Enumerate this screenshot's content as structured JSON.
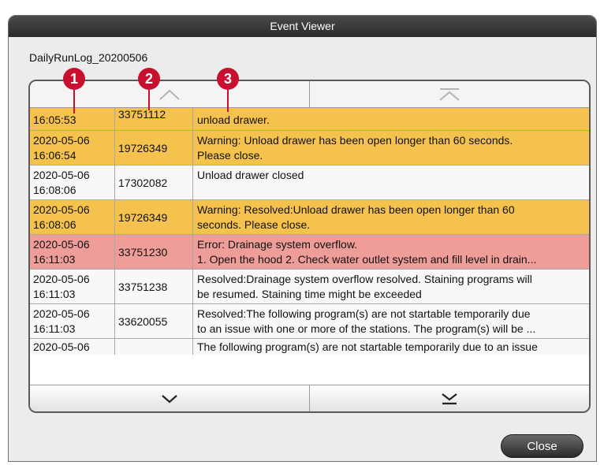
{
  "window": {
    "title": "Event Viewer"
  },
  "log_name": "DailyRunLog_20200506",
  "markers": [
    "1",
    "2",
    "3"
  ],
  "rows": [
    {
      "type": "warn",
      "date": "",
      "time": "16:05:53",
      "event_id": "33751112",
      "message_lines": [
        "unload drawer."
      ]
    },
    {
      "type": "warn",
      "date": "2020-05-06",
      "time": "16:06:54",
      "event_id": "19726349",
      "message_lines": [
        "Warning: Unload drawer has been open longer than 60 seconds.",
        "Please close."
      ]
    },
    {
      "type": "info",
      "date": "2020-05-06",
      "time": "16:08:06",
      "event_id": "17302082",
      "message_lines": [
        "Unload drawer closed"
      ]
    },
    {
      "type": "warn",
      "date": "2020-05-06",
      "time": "16:08:06",
      "event_id": "19726349",
      "message_lines": [
        "Warning: Resolved:Unload drawer has been open longer than 60",
        "seconds. Please close."
      ]
    },
    {
      "type": "error",
      "date": "2020-05-06",
      "time": "16:11:03",
      "event_id": "33751230",
      "message_lines": [
        "Error: Drainage system overflow.",
        "1. Open the hood 2. Check water outlet system and fill level in drain..."
      ]
    },
    {
      "type": "info",
      "date": "2020-05-06",
      "time": "16:11:03",
      "event_id": "33751238",
      "message_lines": [
        "Resolved:Drainage system overflow resolved. Staining programs will",
        "be resumed. Staining time might be exceeded"
      ]
    },
    {
      "type": "info",
      "date": "2020-05-06",
      "time": "16:11:03",
      "event_id": "33620055",
      "message_lines": [
        "Resolved:The following program(s) are not startable temporarily due",
        "to an issue with one or more of the stations. The program(s) will be ..."
      ]
    },
    {
      "type": "info",
      "date": "2020-05-06",
      "time": "",
      "event_id": "",
      "message_lines": [
        "The following program(s) are not startable temporarily due to an issue"
      ]
    }
  ],
  "buttons": {
    "close": "Close"
  },
  "icons": {
    "scroll_up": "chevron-up-icon",
    "scroll_top": "chevron-up-bar-icon",
    "scroll_down": "chevron-down-icon",
    "scroll_bottom": "chevron-down-bar-icon"
  },
  "colors": {
    "warning": "#f4c24d",
    "error": "#ee9d98",
    "info": "#f8f8f8",
    "marker": "#c8102e"
  }
}
